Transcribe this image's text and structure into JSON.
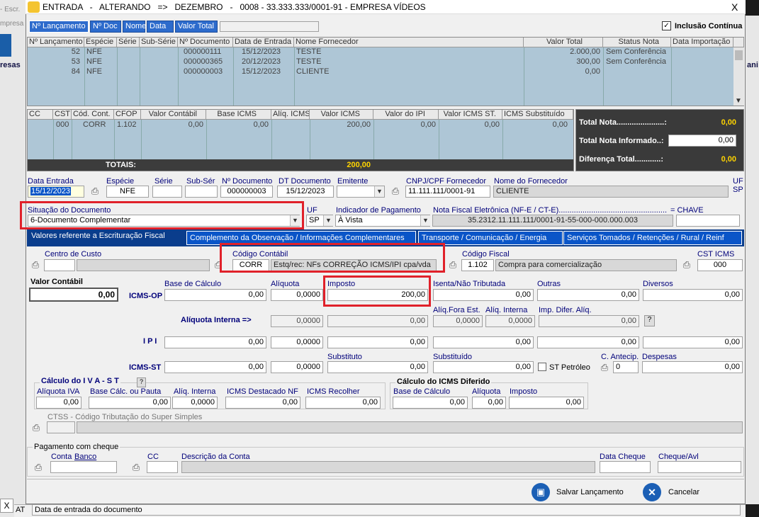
{
  "window": {
    "title": "ENTRADA   -   ALTERANDO   =>   DEZEMBRO   -   0008 - 33.333.333/0001-91 - EMPRESA VÍDEOS",
    "close": "X"
  },
  "bg": {
    "left_top": "- Escr.",
    "left_mid": "mpresa",
    "left_lbl": "resas",
    "right_lbl": "ani",
    "x_btn": "X",
    "at": "AT"
  },
  "search": {
    "tabs": [
      "Nº Lançamento",
      "Nº Doc",
      "Nome",
      "Data",
      "Valor Total"
    ],
    "inclusao": "Inclusão Contínua"
  },
  "entries": {
    "headers": [
      "Nº Lançamento",
      "Espécie",
      "Série",
      "Sub-Série",
      "Nº Documento",
      "Data de Entrada",
      "Nome Fornecedor",
      "Valor Total",
      "Status Nota",
      "Data Importação"
    ],
    "rows": [
      [
        "52",
        "NFE",
        "",
        "",
        "000000111",
        "15/12/2023",
        "TESTE",
        "2.000,00",
        "Sem Conferência",
        ""
      ],
      [
        "53",
        "NFE",
        "",
        "",
        "000000365",
        "20/12/2023",
        "TESTE",
        "300,00",
        "Sem Conferência",
        ""
      ],
      [
        "84",
        "NFE",
        "",
        "",
        "000000003",
        "15/12/2023",
        "CLIENTE",
        "0,00",
        "",
        ""
      ]
    ]
  },
  "items": {
    "headers": [
      "CC",
      "CST",
      "Cód. Cont.",
      "CFOP",
      "Valor Contábil",
      "Base ICMS",
      "Alíq. ICMS",
      "Valor ICMS",
      "Valor do IPI",
      "Valor ICMS ST.",
      "ICMS Substituído"
    ],
    "row": [
      "",
      "000",
      "CORR",
      "1.102",
      "0,00",
      "0,00",
      "",
      "200,00",
      "0,00",
      "0,00",
      "0,00"
    ],
    "totais_label": "TOTAIS:",
    "totais_value": "200,00"
  },
  "totals": {
    "total_nota_label": "Total Nota......................:",
    "total_nota": "0,00",
    "informado_label": "Total Nota Informado..:",
    "informado": "0,00",
    "diferenca_label": "Diferença Total............:",
    "diferenca": "0,00"
  },
  "header": {
    "data_entrada_l": "Data Entrada",
    "data_entrada": "15/12/2023",
    "especie_l": "Espécie",
    "especie": "NFE",
    "serie_l": "Série",
    "subser_l": "Sub-Sér",
    "ndoc_l": "Nº Documento",
    "ndoc": "000000003",
    "dtdoc_l": "DT Documento",
    "dtdoc": "15/12/2023",
    "emitente_l": "Emitente",
    "cnpj_l": "CNPJ/CPF Fornecedor",
    "cnpj": "11.111.111/0001-91",
    "nome_l": "Nome do Fornecedor",
    "nome": "CLIENTE",
    "uf_l": "UF",
    "uf": "SP"
  },
  "row2": {
    "situacao_l": "Situação do Documento",
    "situacao": "6-Documento Complementar",
    "uf_l": "UF",
    "uf": "SP",
    "pag_l": "Indicador de Pagamento",
    "pag": "À Vista",
    "nfe_l": "Nota Fiscal Eletrônica (NF-E / CT-E)..................................................................",
    "nfe": "35.2312.11.111.111/0001-91-55-000-000.000.003",
    "chave_l": "= CHAVE"
  },
  "tabs": [
    "Valores referente a Escrituração Fiscal",
    "Complemento da Observação / Informações Complementares",
    "Transporte / Comunicação / Energia",
    "Serviços Tomados / Retenções / Rural / Reinf"
  ],
  "contab": {
    "cc_l": "Centro de Custo",
    "cod_l": "Código Contábil",
    "cod": "CORR",
    "cod_desc": "Estq/rec: NFs CORREÇÃO ICMS/IPI cpa/vda",
    "fiscal_l": "Código Fiscal",
    "fiscal": "1.102",
    "fiscal_desc": "Compra para comercialização",
    "cst_l": "CST ICMS",
    "cst": "000"
  },
  "valores": {
    "vc_l": "Valor Contábil",
    "vc": "0,00",
    "base_l": "Base de Cálculo",
    "aliq_l": "Alíquota",
    "imp_l": "Imposto",
    "isenta_l": "Isenta/Não Tributada",
    "outras_l": "Outras",
    "div_l": "Diversos",
    "icms_l": "ICMS-OP",
    "icms": [
      "0,00",
      "0,0000",
      "200,00",
      "0,00",
      "0,00",
      "0,00"
    ],
    "aliqfora_l": "Alíq.Fora Est.",
    "aliqint_l": "Alíq. Interna",
    "impdif_l": "Imp. Difer. Alíq.",
    "aliqinterna_l": "Alíquota Interna =>",
    "ai": [
      "0,0000",
      "0,00",
      "0,0000",
      "0,0000",
      "0,00"
    ],
    "help": "?",
    "ipi_l": "I P I",
    "ipi": [
      "0,00",
      "0,0000",
      "0,00",
      "0,00",
      "0,00",
      "0,00"
    ],
    "subst_l": "Substituto",
    "substituido_l": "Substituído",
    "cantecip_l": "C. Antecip.",
    "despesas_l": "Despesas",
    "st_l": "ICMS-ST",
    "st": [
      "0,00",
      "0,0000",
      "0,00",
      "0,00"
    ],
    "stpetro_l": "ST Petróleo",
    "cantecip": "0",
    "despesas": "0,00"
  },
  "iva": {
    "title": "Cálculo  do  I V A - S T",
    "aliq_l": "Alíquota IVA",
    "base_l": "Base Cálc. ou Pauta",
    "aliqint_l": "Alíq. Interna",
    "dest_l": "ICMS Destacado NF",
    "rec_l": "ICMS Recolher",
    "vals": [
      "0,00",
      "0,00",
      "0,0000",
      "0,00",
      "0,00"
    ]
  },
  "dif": {
    "title": "Cálculo do ICMS Diferido",
    "base_l": "Base de Cálculo",
    "aliq_l": "Alíquota",
    "imp_l": "Imposto",
    "vals": [
      "0,00",
      "0,00",
      "0,00"
    ]
  },
  "ctss": {
    "l": "CTSS - Código Tributação do Super Simples"
  },
  "cheque": {
    "title": "Pagamento com cheque",
    "conta_l": "Conta",
    "banco_l": "Banco",
    "cc_l": "CC",
    "desc_l": "Descrição da Conta",
    "data_l": "Data Cheque",
    "avl_l": "Cheque/Avl"
  },
  "footer": {
    "salvar": "Salvar Lançamento",
    "cancelar": "Cancelar",
    "status": "Data de entrada do documento"
  }
}
